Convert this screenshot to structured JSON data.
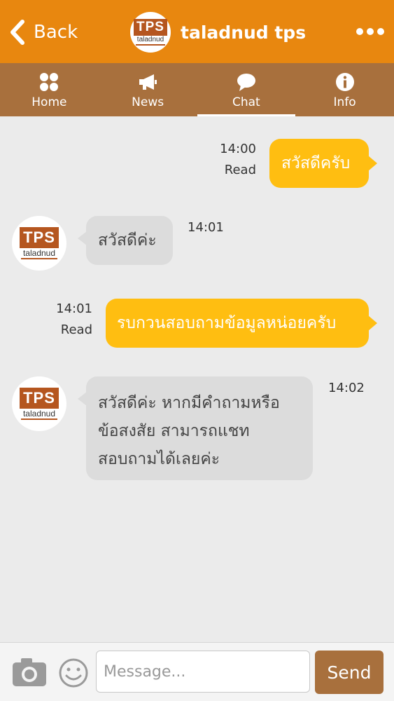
{
  "header": {
    "back_label": "Back",
    "title": "taladnud tps",
    "logo": {
      "main": "TPS",
      "sub": "taladnud"
    },
    "more_icon": "more-dots-icon",
    "color": "#e8870f"
  },
  "tabs": [
    {
      "label": "Home",
      "icon": "grid-icon",
      "active": false
    },
    {
      "label": "News",
      "icon": "megaphone-icon",
      "active": false
    },
    {
      "label": "Chat",
      "icon": "chat-bubble-icon",
      "active": true
    },
    {
      "label": "Info",
      "icon": "info-icon",
      "active": false
    }
  ],
  "messages": [
    {
      "direction": "outgoing",
      "text": "สวัสดีครับ",
      "time": "14:00",
      "status": "Read"
    },
    {
      "direction": "incoming",
      "text": "สวัสดีค่ะ",
      "time": "14:01"
    },
    {
      "direction": "outgoing",
      "text": "รบกวนสอบถามข้อมูลหน่อยครับ",
      "time": "14:01",
      "status": "Read"
    },
    {
      "direction": "incoming",
      "lines": [
        "สวัสดีค่ะ หากมีคำถามหรือ",
        "ข้อสงสัย สามารถแชท",
        "สอบถามได้เลยค่ะ"
      ],
      "time": "14:02"
    }
  ],
  "avatar_logo": {
    "main": "TPS",
    "sub": "taladnud"
  },
  "composer": {
    "placeholder": "Message...",
    "send_label": "Send",
    "camera_icon": "camera-icon",
    "emoji_icon": "smiley-icon"
  },
  "colors": {
    "tab_bar": "#a8703d",
    "outgoing_bubble": "#ffbe11",
    "incoming_bubble": "#dcdcdc",
    "background": "#ebebeb"
  }
}
